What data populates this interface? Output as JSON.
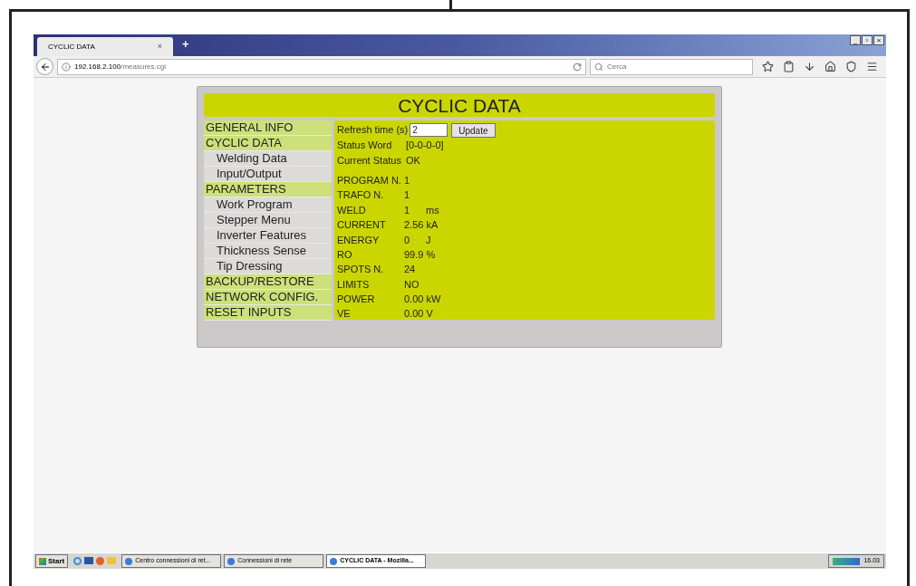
{
  "browser": {
    "tab_title": "CYCLIC DATA",
    "tab_close": "×",
    "new_tab": "+",
    "url_host": "192.168.2.100",
    "url_path": "/measures.cgi",
    "search_placeholder": "Cerca",
    "window_buttons": [
      "_",
      "▫",
      "×"
    ]
  },
  "page": {
    "title": "CYCLIC DATA",
    "menu": [
      {
        "label": "GENERAL INFO",
        "kind": "section"
      },
      {
        "label": "CYCLIC DATA",
        "kind": "section"
      },
      {
        "label": "Welding Data",
        "kind": "sub"
      },
      {
        "label": "Input/Output",
        "kind": "sub"
      },
      {
        "label": "PARAMETERS",
        "kind": "section"
      },
      {
        "label": "Work Program",
        "kind": "sub"
      },
      {
        "label": "Stepper Menu",
        "kind": "sub"
      },
      {
        "label": "Inverter Features",
        "kind": "sub"
      },
      {
        "label": "Thickness Sense",
        "kind": "sub"
      },
      {
        "label": "Tip Dressing",
        "kind": "sub"
      },
      {
        "label": "BACKUP/RESTORE",
        "kind": "section"
      },
      {
        "label": "NETWORK CONFIG.",
        "kind": "section"
      },
      {
        "label": "RESET INPUTS",
        "kind": "section"
      }
    ],
    "refresh_label": "Refresh time (s)",
    "refresh_value": "2",
    "update_button": "Update",
    "status": [
      {
        "label": "Status Word",
        "value": "[0-0-0-0]"
      },
      {
        "label": "Current Status",
        "value": "OK"
      }
    ],
    "measures": [
      {
        "label": "PROGRAM N.",
        "value": "1"
      },
      {
        "label": "TRAFO N.",
        "value": "1"
      },
      {
        "label": "WELD",
        "value": "1",
        "unit": "ms"
      },
      {
        "label": "CURRENT",
        "value": "2.56 kA"
      },
      {
        "label": "ENERGY",
        "value": "0",
        "unit": "J"
      },
      {
        "label": "RO",
        "value": "99.9 %"
      },
      {
        "label": "SPOTS N.",
        "value": "24"
      },
      {
        "label": "LIMITS",
        "value": "NO"
      },
      {
        "label": "POWER",
        "value": "0.00 kW"
      },
      {
        "label": "VE",
        "value": "0.00 V"
      }
    ]
  },
  "taskbar": {
    "start": "Start",
    "items": [
      {
        "label": "Centro connessioni di ret...",
        "selected": false
      },
      {
        "label": "Connessioni di rete",
        "selected": false
      },
      {
        "label": "CYCLIC DATA - Mozilla...",
        "selected": true
      }
    ],
    "clock": "16.03"
  }
}
